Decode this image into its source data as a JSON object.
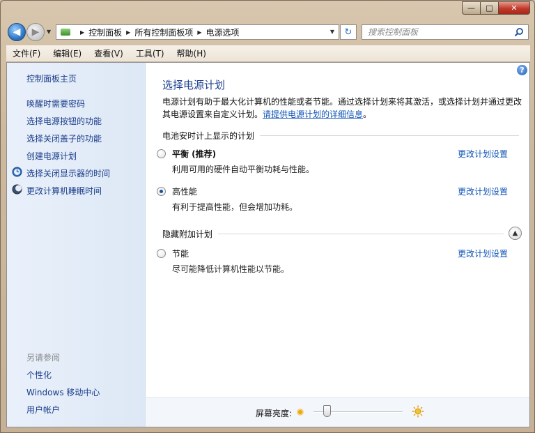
{
  "window": {
    "caption": {
      "minimize": "—",
      "maximize": "□",
      "close": "✕"
    }
  },
  "nav": {
    "back_icon": "back-arrow-icon",
    "forward_icon": "forward-arrow-icon",
    "breadcrumbs": [
      "控制面板",
      "所有控制面板项",
      "电源选项"
    ],
    "search_placeholder": "搜索控制面板"
  },
  "menubar": {
    "items": [
      "文件(F)",
      "编辑(E)",
      "查看(V)",
      "工具(T)",
      "帮助(H)"
    ]
  },
  "sidebar": {
    "home": "控制面板主页",
    "links": [
      "唤醒时需要密码",
      "选择电源按钮的功能",
      "选择关闭盖子的功能",
      "创建电源计划",
      "选择关闭显示器的时间",
      "更改计算机睡眠时间"
    ],
    "see_also_title": "另请参阅",
    "see_also": [
      "个性化",
      "Windows 移动中心",
      "用户帐户"
    ]
  },
  "main": {
    "help": "?",
    "title": "选择电源计划",
    "description": "电源计划有助于最大化计算机的性能或者节能。通过选择计划来将其激活，或选择计划并通过更改其电源设置来自定义计划。",
    "description_link": "请提供电源计划的详细信息",
    "description_end": "。",
    "section_battery": "电池安时计上显示的计划",
    "section_hidden": "隐藏附加计划",
    "change_link": "更改计划设置",
    "plans": [
      {
        "name": "平衡 (推荐)",
        "desc": "利用可用的硬件自动平衡功耗与性能。",
        "selected": false
      },
      {
        "name": "高性能",
        "desc": "有利于提高性能，但会增加功耗。",
        "selected": true
      },
      {
        "name": "节能",
        "desc": "尽可能降低计算机性能以节能。",
        "selected": false
      }
    ]
  },
  "footer": {
    "brightness_label": "屏幕亮度:",
    "brightness_level_percent": 15
  }
}
